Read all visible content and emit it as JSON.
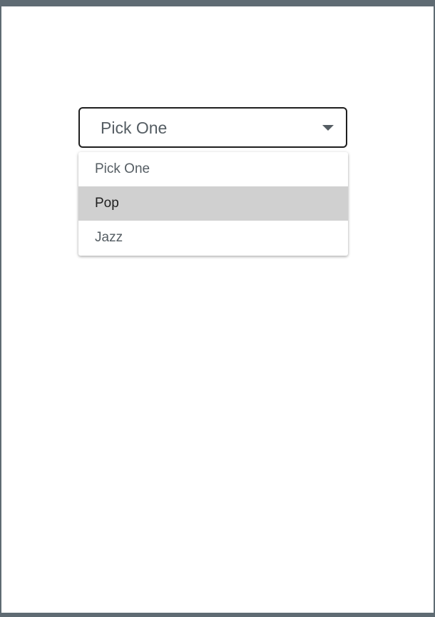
{
  "select": {
    "selected_label": "Pick One",
    "caret_icon": "caret-down-icon"
  },
  "dropdown": {
    "highlighted_index": 1,
    "options": [
      {
        "label": "Pick One"
      },
      {
        "label": "Pop"
      },
      {
        "label": "Jazz"
      }
    ]
  },
  "colors": {
    "frame_border": "#5f6b73",
    "select_border": "#1f1f1f",
    "text": "#555d63",
    "highlight": "#d0d0d0"
  }
}
